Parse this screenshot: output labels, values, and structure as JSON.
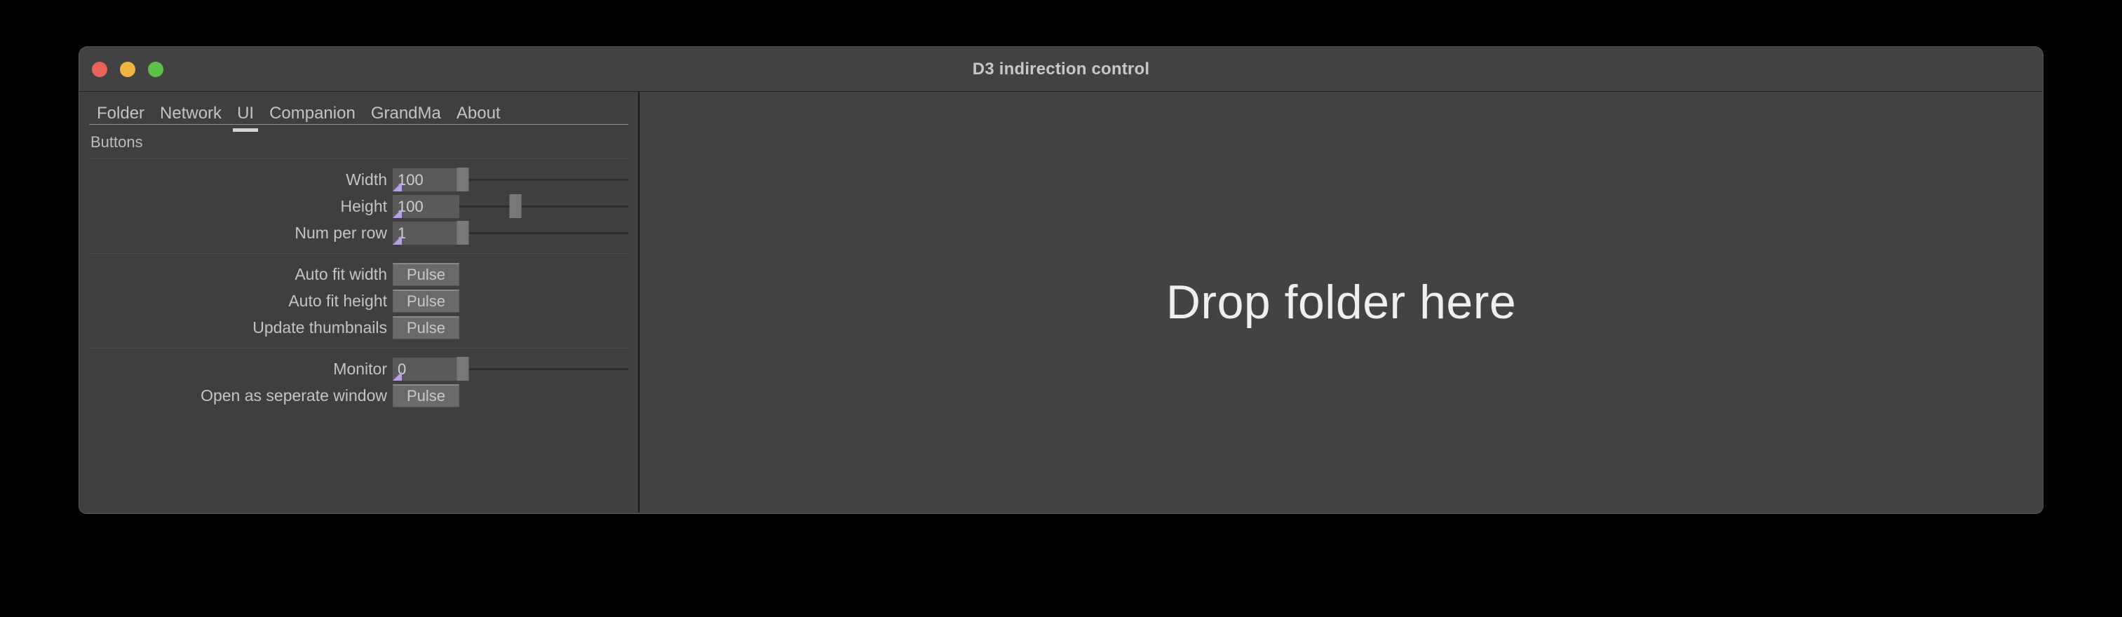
{
  "window": {
    "title": "D3 indirection control",
    "traffic_lights": [
      {
        "name": "close-button",
        "color": "#e8635a"
      },
      {
        "name": "minimize-button",
        "color": "#f0b440"
      },
      {
        "name": "maximize-button",
        "color": "#5dc149"
      }
    ]
  },
  "tabs": [
    {
      "label": "Folder",
      "active": false
    },
    {
      "label": "Network",
      "active": false
    },
    {
      "label": "UI",
      "active": true
    },
    {
      "label": "Companion",
      "active": false
    },
    {
      "label": "GrandMa",
      "active": false
    },
    {
      "label": "About",
      "active": false
    }
  ],
  "left_panel": {
    "section_label": "Buttons",
    "sliders": [
      {
        "label": "Width",
        "value": "100",
        "handle_percent": 2
      },
      {
        "label": "Height",
        "value": "100",
        "handle_percent": 33
      },
      {
        "label": "Num per row",
        "value": "1",
        "handle_percent": 2
      }
    ],
    "pulse_rows": [
      {
        "label": "Auto fit width",
        "button": "Pulse"
      },
      {
        "label": "Auto fit height",
        "button": "Pulse"
      },
      {
        "label": "Update thumbnails",
        "button": "Pulse"
      }
    ],
    "monitor": {
      "label": "Monitor",
      "value": "0",
      "handle_percent": 2
    },
    "separate_window": {
      "label": "Open as seperate window",
      "button": "Pulse"
    }
  },
  "right_panel": {
    "drop_label": "Drop folder here"
  }
}
